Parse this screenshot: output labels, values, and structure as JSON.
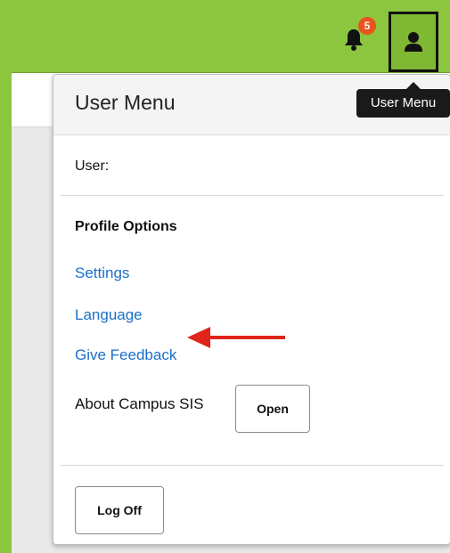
{
  "header": {
    "notification_count": "5",
    "user_menu_tooltip": "User Menu"
  },
  "menu": {
    "title": "User Menu",
    "user_label": "User:",
    "section_title": "Profile Options",
    "links": [
      "Settings",
      "Language",
      "Give Feedback"
    ],
    "about_label": "About Campus SIS",
    "open_button": "Open",
    "logoff_button": "Log Off"
  },
  "annotation": {
    "arrow_color": "#e0251b",
    "points_to": "Settings"
  },
  "colors": {
    "brand_green": "#8cc63f",
    "link_blue": "#1a6fc9",
    "badge_orange": "#e8541e"
  }
}
